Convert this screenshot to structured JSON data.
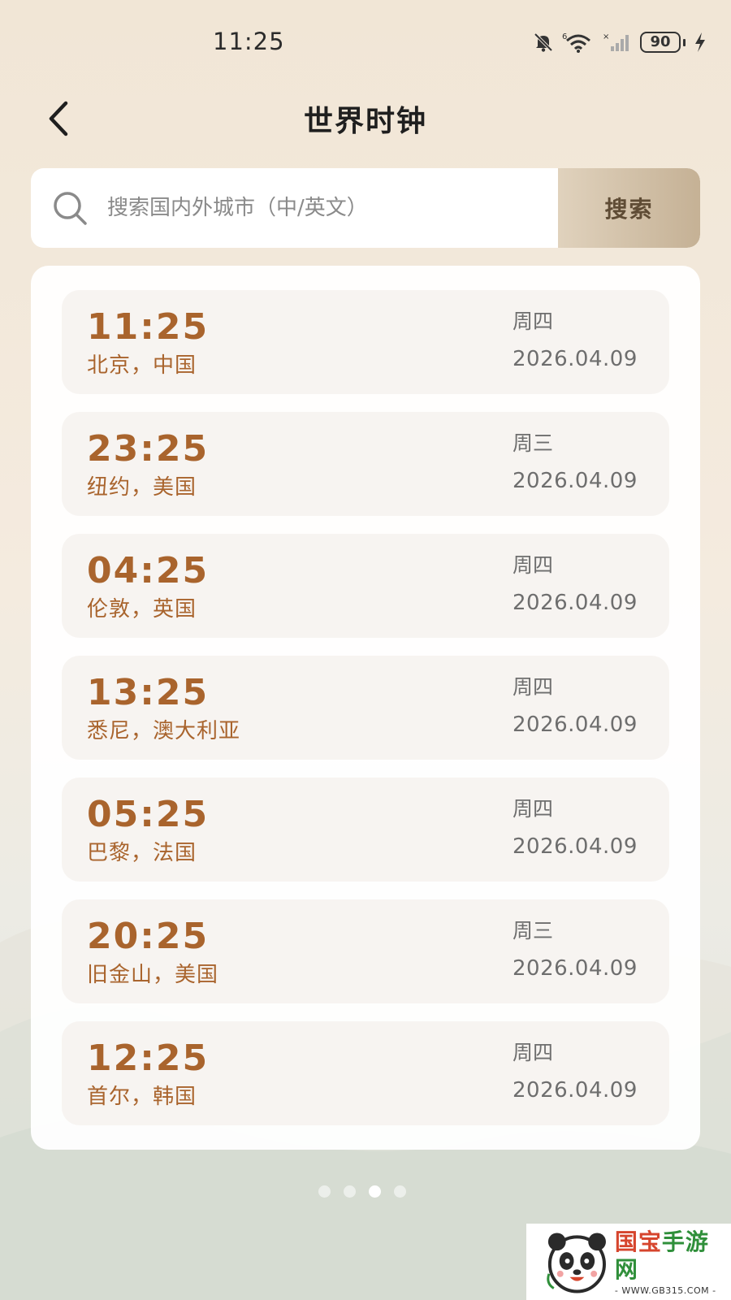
{
  "status_bar": {
    "time": "11:25",
    "battery": "90",
    "signal_prefix": "6"
  },
  "header": {
    "title": "世界时钟"
  },
  "search": {
    "placeholder": "搜索国内外城市（中/英文）",
    "button_label": "搜索"
  },
  "clocks": [
    {
      "time": "11:25",
      "city": "北京，中国",
      "weekday": "周四",
      "date": "2026.04.09"
    },
    {
      "time": "23:25",
      "city": "纽约，美国",
      "weekday": "周三",
      "date": "2026.04.09"
    },
    {
      "time": "04:25",
      "city": "伦敦，英国",
      "weekday": "周四",
      "date": "2026.04.09"
    },
    {
      "time": "13:25",
      "city": "悉尼，澳大利亚",
      "weekday": "周四",
      "date": "2026.04.09"
    },
    {
      "time": "05:25",
      "city": "巴黎，法国",
      "weekday": "周四",
      "date": "2026.04.09"
    },
    {
      "time": "20:25",
      "city": "旧金山，美国",
      "weekday": "周三",
      "date": "2026.04.09"
    },
    {
      "time": "12:25",
      "city": "首尔，韩国",
      "weekday": "周四",
      "date": "2026.04.09"
    }
  ],
  "pager": {
    "count": 4,
    "active_index": 2
  },
  "watermark": {
    "title_red": "国宝",
    "title_green": "手游网",
    "url": "- WWW.GB315.COM -"
  },
  "colors": {
    "accent": "#a9642d",
    "search_button": "#c5b195",
    "card_bg": "#f7f4f1"
  }
}
